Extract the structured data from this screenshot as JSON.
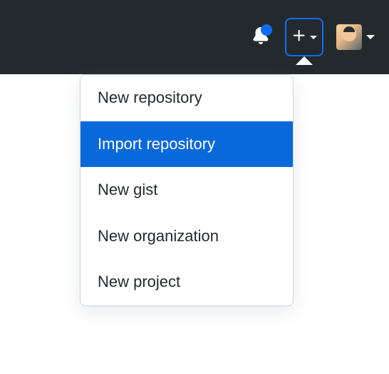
{
  "header": {
    "notifications": {
      "unread": true
    }
  },
  "addMenu": {
    "items": [
      {
        "label": "New repository",
        "active": false
      },
      {
        "label": "Import repository",
        "active": true
      },
      {
        "label": "New gist",
        "active": false
      },
      {
        "label": "New organization",
        "active": false
      },
      {
        "label": "New project",
        "active": false
      }
    ]
  }
}
